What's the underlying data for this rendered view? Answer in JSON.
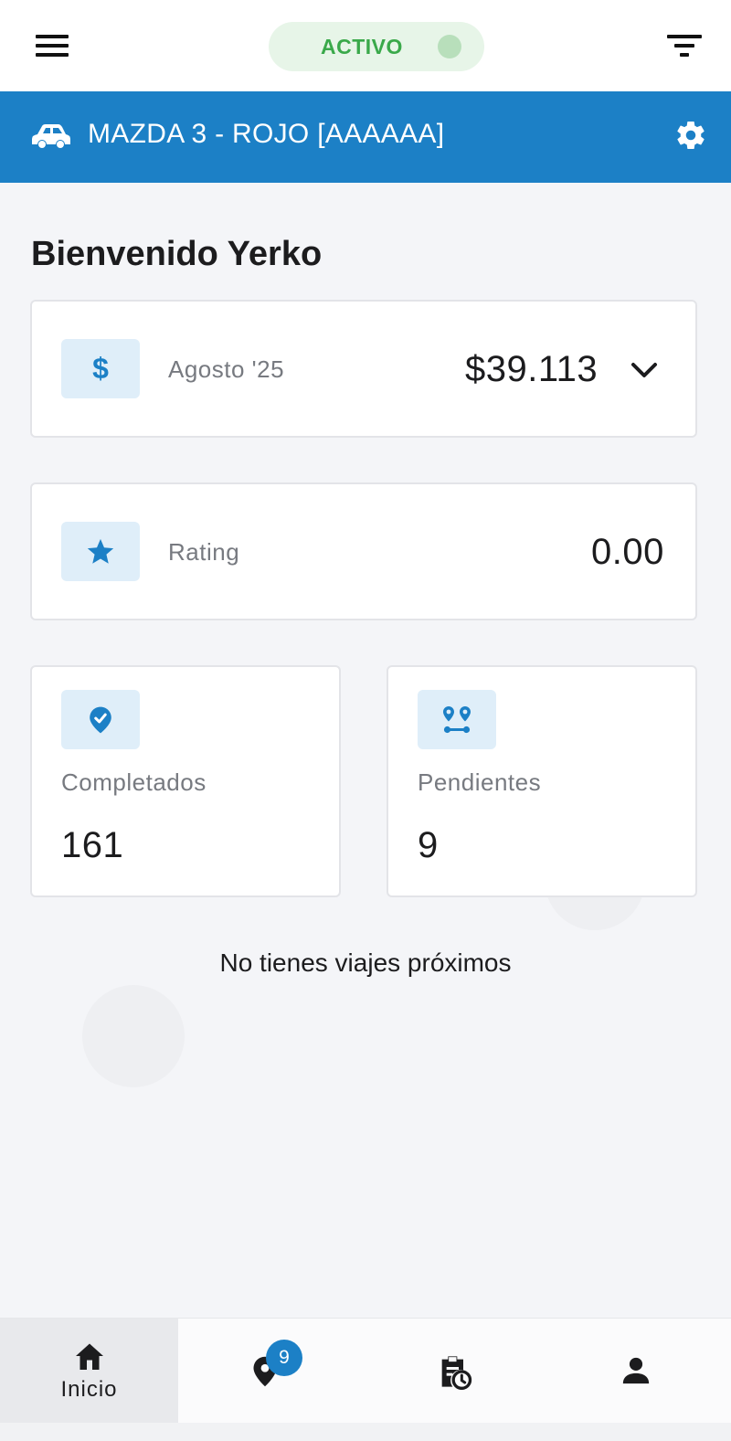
{
  "header": {
    "status_label": "ACTIVO",
    "status_on": true
  },
  "vehicle": {
    "label": "MAZDA 3 - ROJO [AAAAAA]"
  },
  "welcome": "Bienvenido Yerko",
  "earnings": {
    "period": "Agosto '25",
    "amount": "$39.113",
    "icon": "dollar-icon"
  },
  "rating": {
    "label": "Rating",
    "value": "0.00",
    "icon": "star-icon"
  },
  "completed": {
    "label": "Completados",
    "value": "161",
    "icon": "verified-pin-icon"
  },
  "pending": {
    "label": "Pendientes",
    "value": "9",
    "icon": "route-icon"
  },
  "empty_message": "No tienes viajes próximos",
  "nav": {
    "home_label": "Inicio",
    "trips_badge": "9"
  },
  "colors": {
    "primary": "#1c80c6",
    "active_green": "#3aa94a",
    "tile_bg": "#dfeef9"
  }
}
